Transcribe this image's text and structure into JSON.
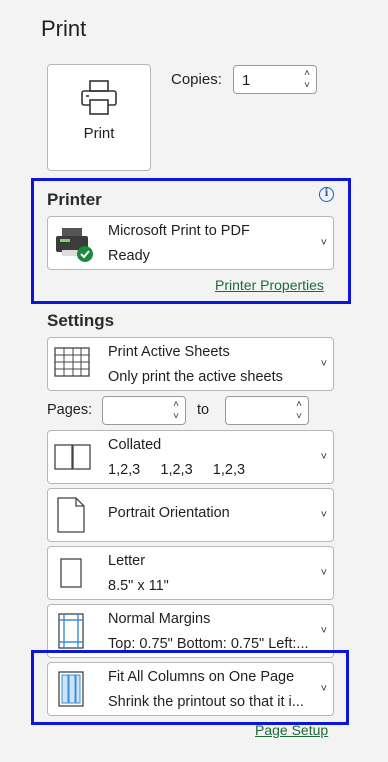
{
  "title": "Print",
  "print_button": {
    "label": "Print"
  },
  "copies": {
    "label": "Copies:",
    "value": "1"
  },
  "printer": {
    "heading": "Printer",
    "info_symbol": "i",
    "name": "Microsoft Print to PDF",
    "status": "Ready",
    "properties_link": "Printer Properties"
  },
  "settings": {
    "heading": "Settings",
    "what": {
      "title": "Print Active Sheets",
      "subtitle": "Only print the active sheets"
    },
    "pages": {
      "label": "Pages:",
      "from": "",
      "to_label": "to",
      "to": ""
    },
    "collation": {
      "title": "Collated",
      "subtitle": "1,2,3     1,2,3     1,2,3"
    },
    "orientation": {
      "title": "Portrait Orientation"
    },
    "paper": {
      "title": "Letter",
      "subtitle": "8.5\" x 11\""
    },
    "margins": {
      "title": "Normal Margins",
      "subtitle": "Top: 0.75\" Bottom: 0.75\" Left:..."
    },
    "scaling": {
      "title": "Fit All Columns on One Page",
      "subtitle": "Shrink the printout so that it i..."
    },
    "page_setup_link": "Page Setup"
  },
  "colors": {
    "highlight": "#0b16d8",
    "link": "#1e6b3a",
    "info": "#1a5fb4",
    "ready_check": "#1b8a3a"
  }
}
